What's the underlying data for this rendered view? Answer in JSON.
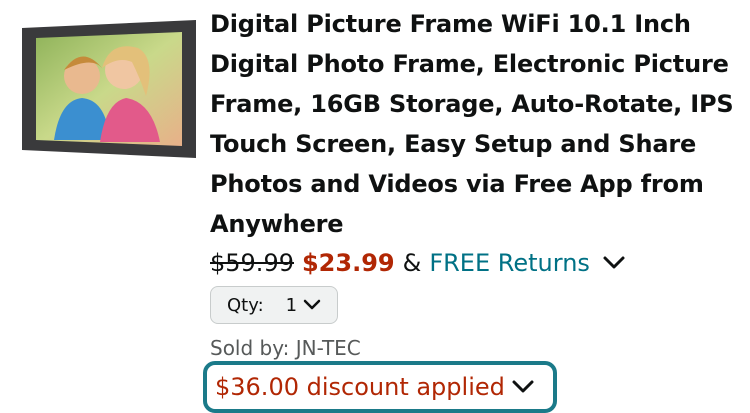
{
  "product": {
    "image_icon": "photo-frame-thumbnail",
    "title_lines": [
      "Digital Picture Frame WiFi 10.1 Inch",
      "Digital Photo Frame, Electronic Picture",
      "Frame, 16GB Storage, Auto-Rotate, IPS",
      "Touch Screen, Easy Setup and Share",
      "Photos and Videos via Free App from",
      "Anywhere"
    ],
    "list_price": "$59.99",
    "sale_price": "$23.99",
    "amp": "&",
    "returns": "FREE Returns",
    "quantity": {
      "label": "Qty:",
      "value": "1"
    },
    "sold_by": "Sold by: JN-TEC",
    "discount": "$36.00 discount applied"
  },
  "colors": {
    "price_red": "#b12704",
    "link_teal": "#007185",
    "focus_ring": "#1b7a89"
  }
}
